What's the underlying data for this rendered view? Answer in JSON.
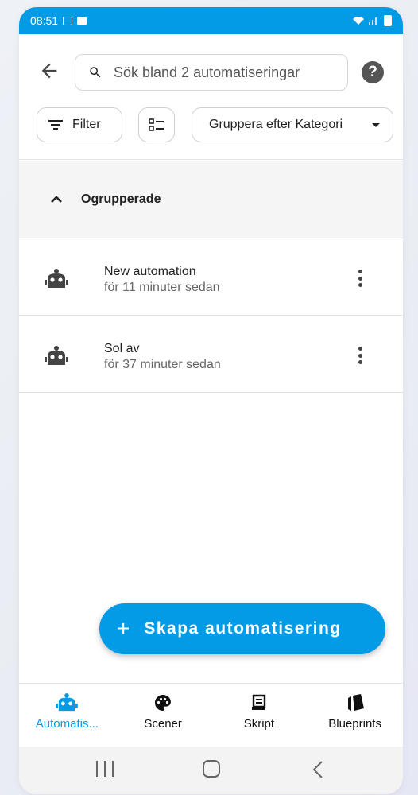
{
  "status_bar": {
    "time": "08:51"
  },
  "search": {
    "placeholder": "Sök bland 2 automatiseringar"
  },
  "filters": {
    "filter_label": "Filter",
    "group_label": "Gruppera efter Kategori"
  },
  "group": {
    "label": "Ogrupperade"
  },
  "automations": [
    {
      "name": "New automation",
      "time": "för 11 minuter sedan"
    },
    {
      "name": "Sol av",
      "time": "för 37 minuter sedan"
    }
  ],
  "fab": {
    "label": "Skapa automatisering"
  },
  "bottom_nav": [
    {
      "label": "Automatis...",
      "icon": "robot-icon",
      "active": true
    },
    {
      "label": "Scener",
      "icon": "palette-icon"
    },
    {
      "label": "Skript",
      "icon": "script-icon"
    },
    {
      "label": "Blueprints",
      "icon": "blueprint-icon"
    }
  ],
  "colors": {
    "accent": "#039be5"
  }
}
